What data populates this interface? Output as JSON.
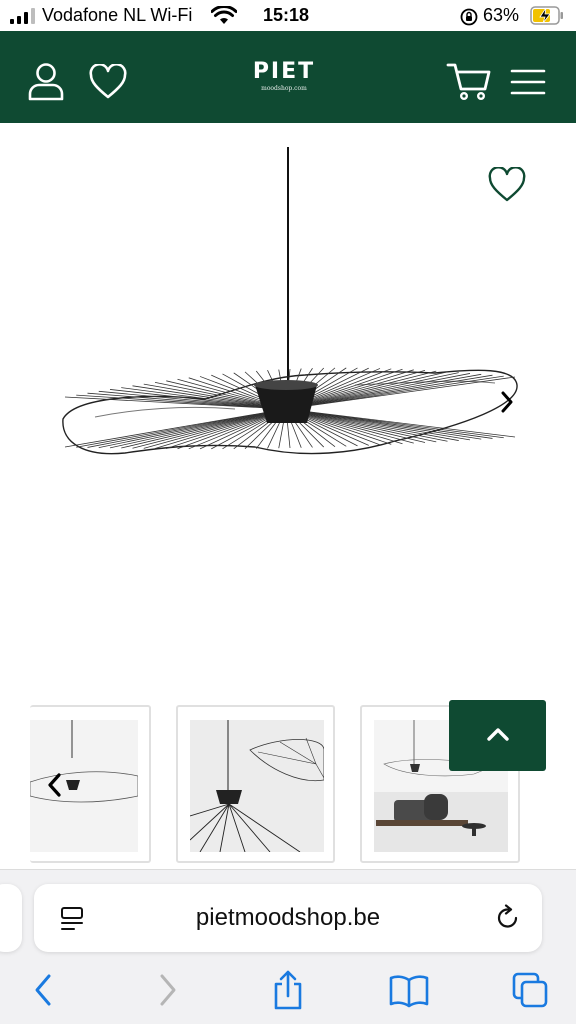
{
  "status_bar": {
    "carrier": "Vodafone NL Wi-Fi",
    "time": "15:18",
    "battery_percent": "63%",
    "icons": [
      "signal-bars-icon",
      "wifi-icon",
      "rotation-lock-icon",
      "battery-charging-icon"
    ]
  },
  "header": {
    "background_color": "#0f4a32",
    "logo_text": "PIET",
    "logo_subtext": "moodshop.com",
    "icons": [
      "account-icon",
      "wishlist-heart-icon",
      "cart-icon",
      "menu-hamburger-icon"
    ]
  },
  "product_gallery": {
    "image_description_icon": "pendant-lamp",
    "favorite_icon": "heart-outline-icon",
    "next_icon": "chevron-right-icon",
    "prev_icon": "chevron-left-icon"
  },
  "thumbnails": {
    "count_visible": 3,
    "back_to_top_icon": "chevron-up-icon"
  },
  "safari": {
    "url": "pietmoodshop.be",
    "icons": [
      "reader-mode-icon",
      "reload-icon",
      "back-icon",
      "forward-icon",
      "share-icon",
      "bookmarks-icon",
      "tabs-icon"
    ],
    "accent_color": "#1a7ae0"
  }
}
